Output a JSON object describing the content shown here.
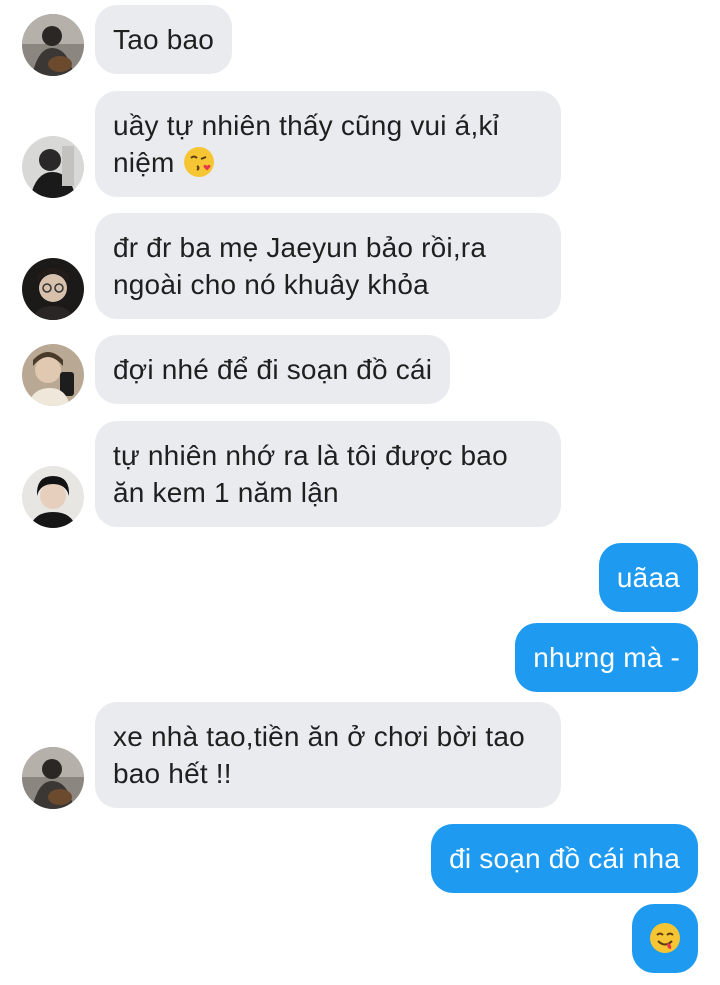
{
  "messages": [
    {
      "text": "Tao bao"
    },
    {
      "text": "uầy tự nhiên thấy cũng vui á,kỉ niệm",
      "emoji": "kissing-heart-emoji"
    },
    {
      "text": "đr đr ba mẹ Jaeyun bảo rồi,ra ngoài cho nó khuây khỏa"
    },
    {
      "text": "đợi nhé để đi soạn đồ cái"
    },
    {
      "text": "tự nhiên nhớ ra là tôi được bao ăn kem 1 năm lận"
    },
    {
      "text": "uãaa"
    },
    {
      "text": "nhưng mà -"
    },
    {
      "text": "xe nhà tao,tiền ăn ở chơi bời tao bao hết !!"
    },
    {
      "text": "đi soạn đồ cái nha"
    },
    {
      "text": "",
      "emoji": "yum-face-emoji"
    }
  ],
  "colors": {
    "incoming_bubble": "#e9ebef",
    "outgoing_bubble": "#1e9bf0",
    "incoming_text": "#1f1f1f",
    "outgoing_text": "#ffffff"
  }
}
